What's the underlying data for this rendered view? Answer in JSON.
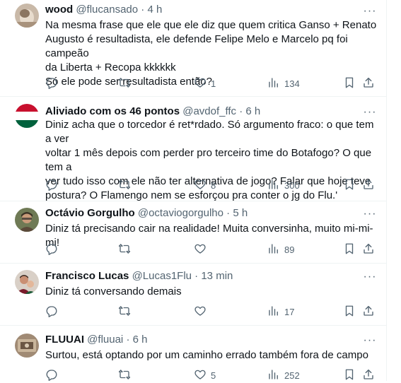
{
  "tweets": [
    {
      "name": "wood",
      "handle": "@flucansado",
      "sep": "·",
      "time": "4 h",
      "text": "Na mesma frase que ele que ele diz que quem critica Ganso + Renato\nAugusto é resultadista, ele defende Felipe Melo e Marcelo pq foi campeão\nda Liberta + Recopa kkkkkk\nSó ele pode ser resultadista então?",
      "replies": "",
      "retweets": "",
      "likes": "1",
      "views": "134"
    },
    {
      "name": "Aliviado com os 46 pontos",
      "handle": "@avdof_ffc",
      "sep": "·",
      "time": "6 h",
      "text": "Diniz acha que o torcedor é ret*rdado. Só argumento fraco: o que tem a ver\nvoltar 1 mês depois com perder pro terceiro time do Botafogo? O que tem a\nver tudo isso com ele não ter alternativa de jogo? Falar que hoje teve\npostura? O Flamengo nem se esforçou pra conter o jg do Flu.'",
      "replies": "",
      "retweets": "",
      "likes": "8",
      "views": "300"
    },
    {
      "name": "Octávio Gorgulho",
      "handle": "@octaviogorgulho",
      "sep": "·",
      "time": "5 h",
      "text": "Diniz tá precisando cair na realidade! Muita conversinha, muito mi-mi-mi!",
      "replies": "",
      "retweets": "",
      "likes": "",
      "views": "89"
    },
    {
      "name": "Francisco Lucas",
      "handle": "@Lucas1Flu",
      "sep": "·",
      "time": "13 min",
      "text": "Diniz tá conversando demais",
      "replies": "",
      "retweets": "",
      "likes": "",
      "views": "17"
    },
    {
      "name": "FLUUAI",
      "handle": "@fluuai",
      "sep": "·",
      "time": "6 h",
      "text": "Surtou, está optando por um caminho errado também fora de campo",
      "replies": "",
      "retweets": "",
      "likes": "5",
      "views": "252"
    }
  ],
  "icons": {
    "reply": "reply-icon",
    "retweet": "retweet-icon",
    "like": "heart-icon",
    "views": "views-icon",
    "bookmark": "bookmark-icon",
    "share": "share-icon",
    "more": "more-icon"
  },
  "colors": {
    "text": "#0f1419",
    "secondary": "#536471",
    "border": "#eff3f4",
    "flag_red": "#c8102e",
    "flag_green": "#00613c"
  }
}
